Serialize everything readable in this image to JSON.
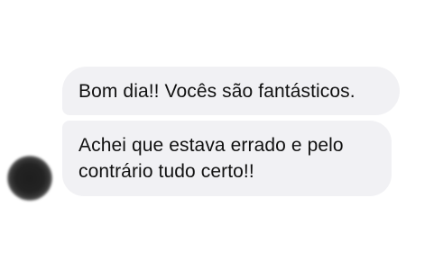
{
  "messages": [
    {
      "text": "Bom dia!! Vocês são fantásticos."
    },
    {
      "text": "Achei que estava errado e pelo contrário tudo certo!!"
    }
  ],
  "colors": {
    "bubble_background": "#f1f1f4",
    "text": "#111111",
    "avatar": "#232323"
  }
}
